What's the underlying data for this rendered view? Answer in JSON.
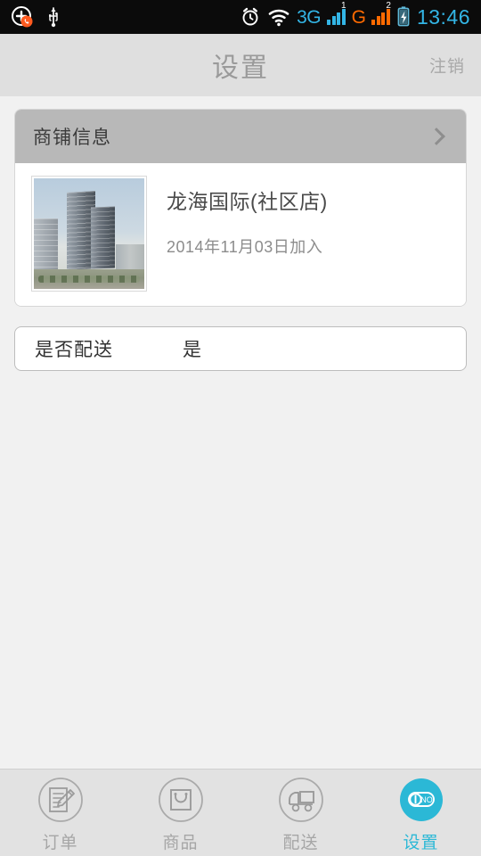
{
  "statusbar": {
    "left_icons": [
      {
        "name": "call-add-icon",
        "glyph": "circle-plus-phone"
      },
      {
        "name": "usb-icon",
        "glyph": "usb"
      }
    ],
    "alarm_icon": "alarm-clock-icon",
    "wifi_icon": "wifi-icon",
    "network_1": {
      "label": "3G",
      "sup": "1",
      "color": "#33b5e5"
    },
    "network_2": {
      "label": "G",
      "sup": "2",
      "color": "#ff6a00"
    },
    "battery_icon": "battery-charging-icon",
    "time": "13:46"
  },
  "header": {
    "title": "设置",
    "action_label": "注销"
  },
  "shop_card": {
    "head_title": "商铺信息",
    "chevron": "chevron-right-icon",
    "photo_alt": "商铺照片",
    "name": "龙海国际(社区店)",
    "joined": "2014年11月03日加入"
  },
  "delivery_setting": {
    "label": "是否配送",
    "value": "是"
  },
  "tabbar": {
    "items": [
      {
        "label": "订单",
        "icon": "orders-icon",
        "active": false
      },
      {
        "label": "商品",
        "icon": "products-icon",
        "active": false
      },
      {
        "label": "配送",
        "icon": "delivery-icon",
        "active": false
      },
      {
        "label": "设置",
        "icon": "settings-toggle-icon",
        "active": true
      }
    ],
    "active_color": "#2bb8d6",
    "toggle_text": "NO"
  }
}
